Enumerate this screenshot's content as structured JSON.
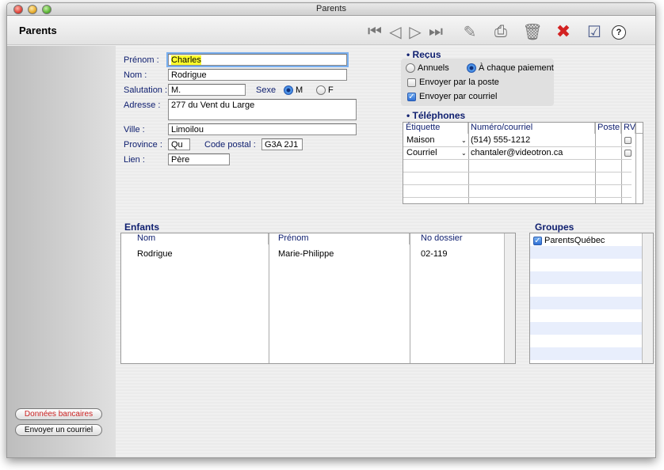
{
  "window": {
    "title": "Parents"
  },
  "header": {
    "app_title": "Parents"
  },
  "toolbar": {
    "first": "⏮",
    "prev": "◁",
    "next": "▷",
    "last": "⏭",
    "export": "✎",
    "print": "⎙",
    "trash": "🗑",
    "delete": "✖",
    "edit": "☑",
    "help": "?"
  },
  "form": {
    "prenom_label": "Prénom :",
    "prenom_value": "Charles",
    "nom_label": "Nom :",
    "nom_value": "Rodrigue",
    "salutation_label": "Salutation :",
    "salutation_value": "M.",
    "sexe_label": "Sexe",
    "sexe_m": "M",
    "sexe_f": "F",
    "adresse_label": "Adresse :",
    "adresse_value": "277 du Vent du Large",
    "ville_label": "Ville :",
    "ville_value": "Limoilou",
    "province_label": "Province :",
    "province_value": "Qu",
    "postal_label": "Code postal :",
    "postal_value": "G3A 2J1",
    "lien_label": "Lien :",
    "lien_value": "Père"
  },
  "recus": {
    "title": "• Reçus",
    "annuels": "Annuels",
    "chaque": "À chaque paiement",
    "poste": "Envoyer par la poste",
    "courriel": "Envoyer par courriel"
  },
  "telephones": {
    "title": "• Téléphones",
    "columns": [
      "Étiquette",
      "Numéro/courriel",
      "Poste",
      "RV"
    ],
    "rows": [
      {
        "etiquette": "Maison",
        "numero": "(514) 555-1212"
      },
      {
        "etiquette": "Courriel",
        "numero": "chantaler@videotron.ca"
      }
    ]
  },
  "enfants": {
    "title": "Enfants",
    "columns": [
      "Nom",
      "Prénom",
      "No dossier"
    ],
    "rows": [
      {
        "nom": "Rodrigue",
        "prenom": "Marie-Philippe",
        "dossier": "02-119"
      }
    ]
  },
  "groupes": {
    "title": "Groupes",
    "items": [
      "ParentsQuébec"
    ]
  },
  "sidebar": {
    "bank_button": "Données bancaires",
    "email_button": "Envoyer un courriel"
  },
  "colors": {
    "accent": "#2a72d8",
    "label": "#102070",
    "highlight": "#ffff2b",
    "bank_text": "#cc2222"
  }
}
